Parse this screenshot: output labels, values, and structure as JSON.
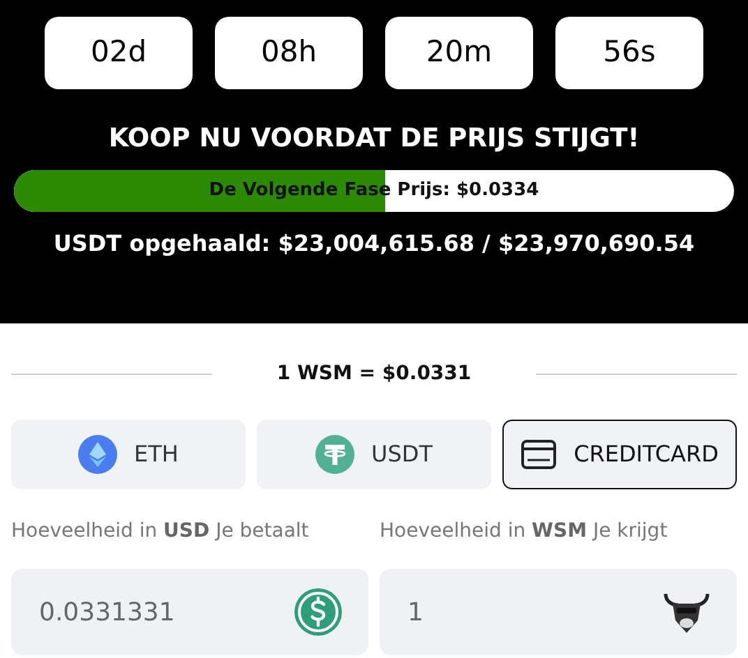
{
  "countdown": [
    {
      "value": "02d"
    },
    {
      "value": "08h"
    },
    {
      "value": "20m"
    },
    {
      "value": "56s"
    }
  ],
  "headline": "KOOP NU VOORDAT DE PRIJS STIJGT!",
  "progress": {
    "label": "De Volgende Fase Prijs: $0.0334",
    "level": 0.515
  },
  "raised": "USDT opgehaald: $23,004,615.68 / $23,970,690.54",
  "rate": "1 WSM = $0.0331",
  "payment_methods": [
    {
      "kind": "eth",
      "label": "ETH",
      "selected": false
    },
    {
      "kind": "usdt",
      "label": "USDT",
      "selected": false
    },
    {
      "kind": "card",
      "label": "CREDITCARD",
      "selected": true
    }
  ],
  "fields": [
    {
      "label": "Hoeveelheid in **USD** Je betaalt",
      "value": "0.0331331",
      "kind": "usd"
    },
    {
      "label": "Hoeveelheid in **WSM** Je krijgt",
      "value": "1",
      "kind": "wsm"
    }
  ]
}
